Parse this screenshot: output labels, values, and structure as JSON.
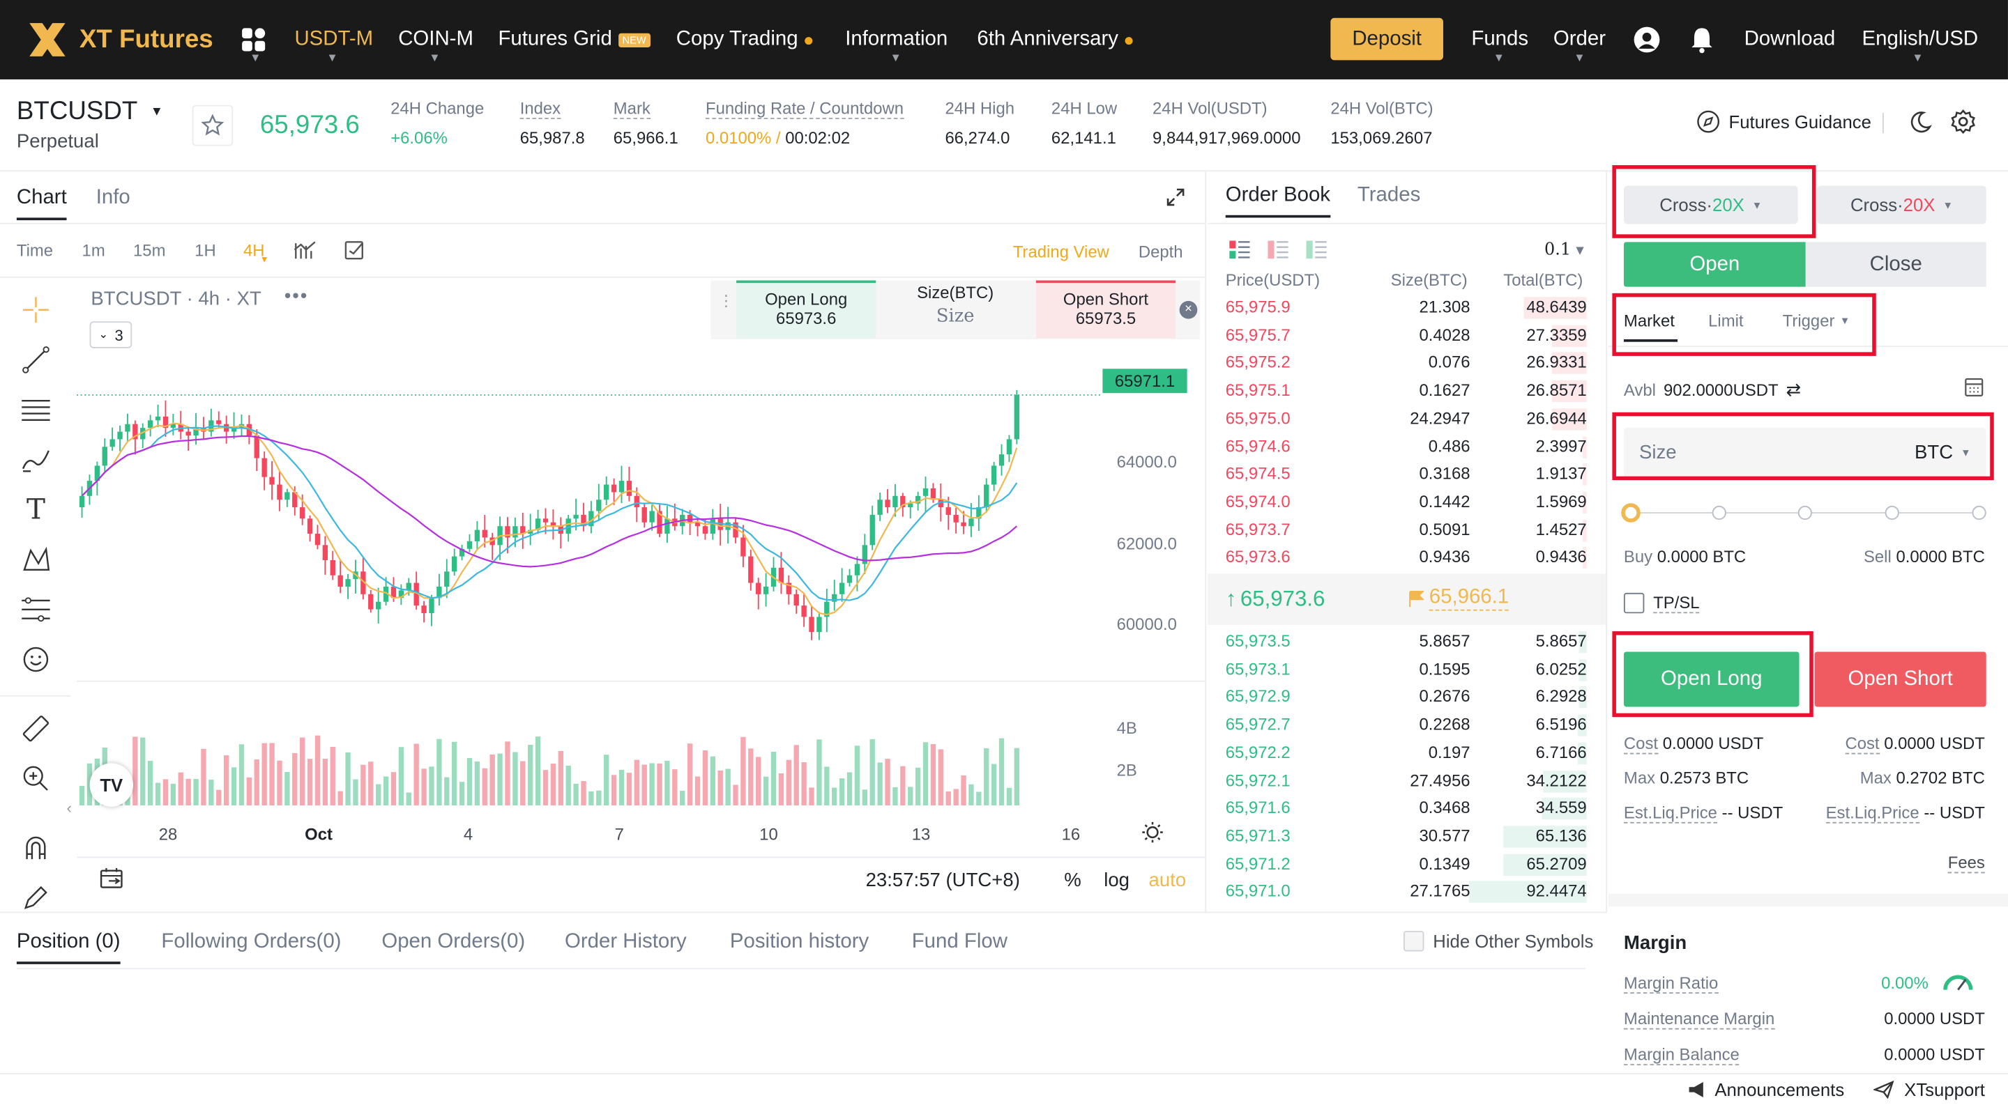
{
  "nav": {
    "logo": "XT Futures",
    "items": [
      "USDT-M",
      "COIN-M",
      "Futures Grid",
      "Copy Trading",
      "Information",
      "6th Anniversary"
    ],
    "new_badge": "NEW",
    "deposit": "Deposit",
    "right": [
      "Funds",
      "Order",
      "Download",
      "English/USD"
    ]
  },
  "ticker": {
    "symbol": "BTCUSDT",
    "type": "Perpetual",
    "last_price": "65,973.6",
    "change_label": "24H Change",
    "change_val": "+6.06%",
    "index_label": "Index",
    "index_val": "65,987.8",
    "mark_label": "Mark",
    "mark_val": "65,966.1",
    "funding_label": "Funding Rate / Countdown",
    "funding_rate": "0.0100%",
    "funding_sep": " / ",
    "countdown": "00:02:02",
    "high_label": "24H High",
    "high_val": "66,274.0",
    "low_label": "24H Low",
    "low_val": "62,141.1",
    "volu_label": "24H Vol(USDT)",
    "volu_val": "9,844,917,969.0000",
    "volb_label": "24H Vol(BTC)",
    "volb_val": "153,069.2607",
    "guidance": "Futures Guidance"
  },
  "chart": {
    "tabs": [
      "Chart",
      "Info"
    ],
    "intervals": [
      "Time",
      "1m",
      "15m",
      "1H",
      "4H"
    ],
    "view_trading": "Trading View",
    "view_depth": "Depth",
    "legend": "BTCUSDT · 4h · XT",
    "legend_count": "3",
    "quick_open_long": "Open Long",
    "quick_long_price": "65973.6",
    "quick_size_label": "Size(BTC)",
    "quick_size_placeholder": "Size",
    "quick_open_short": "Open Short",
    "quick_short_price": "65973.5",
    "price_tag": "65971.1",
    "y_ticks": [
      "64000.0",
      "62000.0",
      "60000.0"
    ],
    "vol_ticks": [
      "4B",
      "2B"
    ],
    "x_ticks": [
      "28",
      "Oct",
      "4",
      "7",
      "10",
      "13",
      "16"
    ],
    "time_display": "23:57:57 (UTC+8)",
    "scale_pct": "%",
    "scale_log": "log",
    "scale_auto": "auto"
  },
  "chart_data": {
    "type": "candlestick",
    "interval": "4h",
    "ylim": [
      58500,
      66800
    ],
    "x_ticks": [
      "28",
      "Oct",
      "4",
      "7",
      "10",
      "13",
      "16"
    ],
    "closes": [
      63300,
      63700,
      64100,
      64600,
      64800,
      65000,
      65200,
      64800,
      65100,
      65300,
      65400,
      65100,
      65200,
      65000,
      64900,
      65100,
      65000,
      65300,
      65200,
      65000,
      65100,
      65200,
      64900,
      64300,
      63800,
      63600,
      63200,
      63400,
      63000,
      62700,
      62300,
      62000,
      61600,
      61200,
      60900,
      61100,
      61300,
      60700,
      60300,
      60500,
      60900,
      60600,
      60800,
      61000,
      60400,
      60200,
      60600,
      60900,
      61300,
      61700,
      61900,
      62100,
      62400,
      62200,
      62000,
      62500,
      62200,
      62500,
      62300,
      62400,
      62700,
      62600,
      62500,
      62300,
      62700,
      62800,
      62500,
      62900,
      63200,
      63600,
      63400,
      63700,
      63300,
      63000,
      62600,
      62900,
      62300,
      62700,
      62500,
      62800,
      62600,
      62500,
      62300,
      62700,
      62400,
      62600,
      62200,
      61700,
      61000,
      60700,
      60900,
      61400,
      61000,
      60700,
      60400,
      60100,
      59700,
      60100,
      60500,
      60700,
      61000,
      61200,
      61500,
      62000,
      62800,
      63200,
      63000,
      63300,
      63000,
      63100,
      63300,
      63500,
      63200,
      63000,
      62800,
      62600,
      62500,
      62700,
      63000,
      63600,
      64100,
      64400,
      64800,
      65971
    ]
  },
  "orderbook": {
    "tabs": [
      "Order Book",
      "Trades"
    ],
    "precision": "0.1",
    "headers": [
      "Price(USDT)",
      "Size(BTC)",
      "Total(BTC)"
    ],
    "asks": [
      [
        "65,975.9",
        "21.308",
        "48.6439"
      ],
      [
        "65,975.7",
        "0.4028",
        "27.3359"
      ],
      [
        "65,975.2",
        "0.076",
        "26.9331"
      ],
      [
        "65,975.1",
        "0.1627",
        "26.8571"
      ],
      [
        "65,975.0",
        "24.2947",
        "26.6944"
      ],
      [
        "65,974.6",
        "0.486",
        "2.3997"
      ],
      [
        "65,974.5",
        "0.3168",
        "1.9137"
      ],
      [
        "65,974.0",
        "0.1442",
        "1.5969"
      ],
      [
        "65,973.7",
        "0.5091",
        "1.4527"
      ],
      [
        "65,973.6",
        "0.9436",
        "0.9436"
      ]
    ],
    "last_price": "65,973.6",
    "mark_price": "65,966.1",
    "bids": [
      [
        "65,973.5",
        "5.8657",
        "5.8657"
      ],
      [
        "65,973.1",
        "0.1595",
        "6.0252"
      ],
      [
        "65,972.9",
        "0.2676",
        "6.2928"
      ],
      [
        "65,972.7",
        "0.2268",
        "6.5196"
      ],
      [
        "65,972.2",
        "0.197",
        "6.7166"
      ],
      [
        "65,972.1",
        "27.4956",
        "34.2122"
      ],
      [
        "65,971.6",
        "0.3468",
        "34.559"
      ],
      [
        "65,971.3",
        "30.577",
        "65.136"
      ],
      [
        "65,971.2",
        "0.1349",
        "65.2709"
      ],
      [
        "65,971.0",
        "27.1765",
        "92.4474"
      ]
    ]
  },
  "trade": {
    "cross_left_prefix": "Cross·",
    "cross_left_lev": "20X",
    "cross_right_prefix": "Cross·",
    "cross_right_lev": "20X",
    "open_tab": "Open",
    "close_tab": "Close",
    "order_types": [
      "Market",
      "Limit",
      "Trigger"
    ],
    "avbl_label": "Avbl",
    "avbl_val": "902.0000USDT",
    "size_placeholder": "Size",
    "size_unit": "BTC",
    "slider_pct": 0,
    "buy_label": "Buy",
    "buy_val": "0.0000 BTC",
    "sell_label": "Sell",
    "sell_val": "0.0000 BTC",
    "tpsl": "TP/SL",
    "open_long": "Open Long",
    "open_short": "Open Short",
    "cost_label": "Cost",
    "cost_long": "0.0000 USDT",
    "cost_short": "0.0000 USDT",
    "max_label": "Max",
    "max_long": "0.2573 BTC",
    "max_short": "0.2702 BTC",
    "liq_label": "Est.Liq.Price",
    "liq_long": "-- USDT",
    "liq_short": "-- USDT",
    "fees": "Fees",
    "margin_title": "Margin",
    "margin_ratio_label": "Margin Ratio",
    "margin_ratio_val": "0.00%",
    "maint_label": "Maintenance Margin",
    "maint_val": "0.0000 USDT",
    "balance_label": "Margin Balance",
    "balance_val": "0.0000 USDT"
  },
  "bottom": {
    "tabs": [
      "Position (0)",
      "Following Orders(0)",
      "Open Orders(0)",
      "Order History",
      "Position history",
      "Fund Flow"
    ],
    "hide_other": "Hide Other Symbols"
  },
  "footer": {
    "announcements": "Announcements",
    "support": "XTsupport"
  },
  "colors": {
    "green": "#2ebd85",
    "red": "#f6465d",
    "accent": "#f0b84f",
    "highlight_box": "#e8102e"
  }
}
